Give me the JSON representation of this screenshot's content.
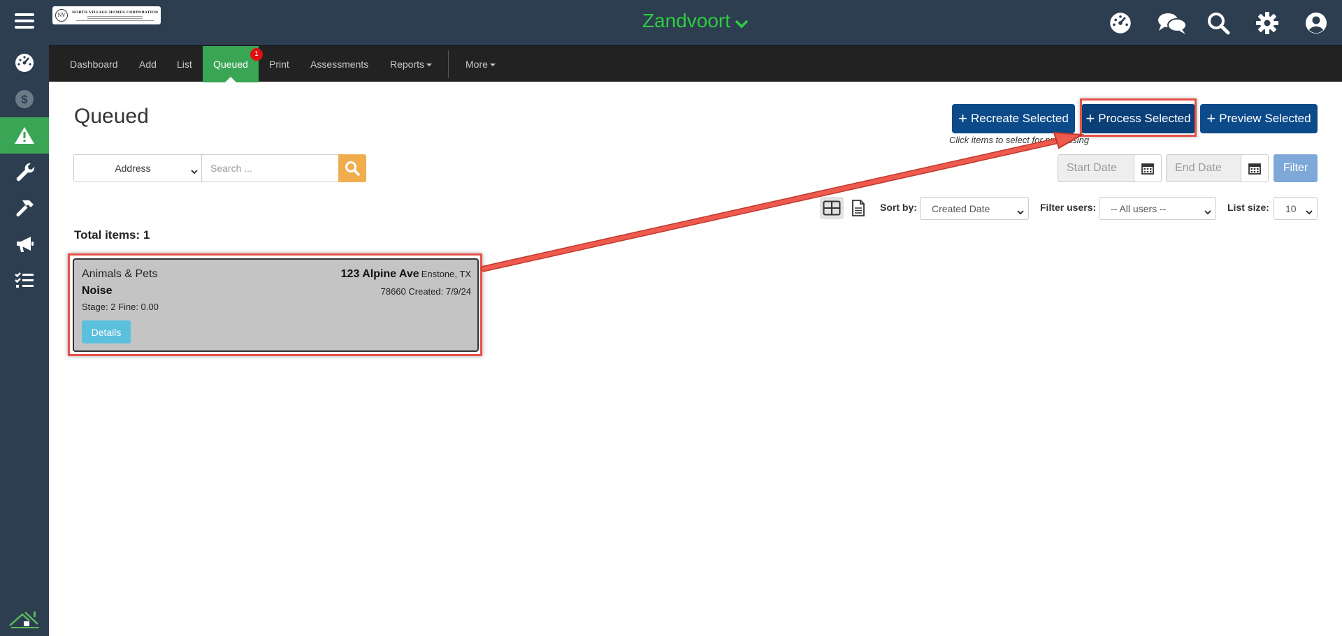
{
  "header": {
    "logo_text": "NORTH VILLAGE HOMES CORPORATION",
    "community": "Zandvoort"
  },
  "sidebar": {
    "items": [
      {
        "icon": "menu-icon"
      },
      {
        "icon": "dashboard-icon"
      },
      {
        "icon": "dollar-icon"
      },
      {
        "icon": "warning-icon",
        "active": true
      },
      {
        "icon": "wrench-icon"
      },
      {
        "icon": "hammer-icon"
      },
      {
        "icon": "megaphone-icon"
      },
      {
        "icon": "checklist-icon"
      }
    ]
  },
  "top_icons": [
    "dashboard-icon",
    "chat-icon",
    "search-icon",
    "gear-icon",
    "user-icon"
  ],
  "nav": {
    "dashboard": "Dashboard",
    "add": "Add",
    "list": "List",
    "queued": "Queued",
    "queued_badge": "1",
    "print": "Print",
    "assessments": "Assessments",
    "reports": "Reports",
    "more": "More"
  },
  "page": {
    "title": "Queued",
    "recreate_label": "Recreate Selected",
    "process_label": "Process Selected",
    "preview_label": "Preview Selected",
    "hint": "Click items to select for processing"
  },
  "search": {
    "field_value": "Address",
    "placeholder": "Search ..."
  },
  "dates": {
    "start_placeholder": "Start Date",
    "end_placeholder": "End Date",
    "filter_label": "Filter"
  },
  "controls": {
    "sort_label": "Sort by:",
    "sort_value": "Created Date",
    "filter_users_label": "Filter users:",
    "filter_users_value": "-- All users --",
    "list_size_label": "List size:",
    "list_size_value": "10"
  },
  "list": {
    "total": "Total items: 1",
    "items": [
      {
        "category": "Animals & Pets",
        "type": "Noise",
        "stage": "Stage: 2 Fine: 0.00",
        "street": "123 Alpine Ave",
        "city": "Enstone, TX",
        "meta": "78660 Created: 7/9/24",
        "details_label": "Details"
      }
    ]
  },
  "colors": {
    "sidebar_bg": "#2d3e50",
    "active_green": "#3aa655",
    "primary_blue": "#0c4a8a",
    "annotation_red": "#e8524a"
  }
}
